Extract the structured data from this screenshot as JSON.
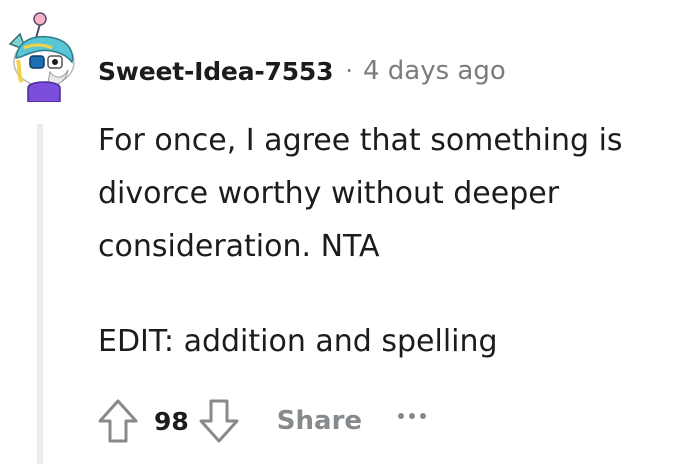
{
  "comment": {
    "author": "Sweet-Idea-7553",
    "separator": "·",
    "timestamp": "4 days ago",
    "body_lines": [
      "For once, I agree that something is divorce worthy without deeper consideration. NTA",
      "EDIT: addition and spelling"
    ],
    "score": "98",
    "share_label": "Share"
  },
  "icons": {
    "avatar": "snoo-avatar-icon",
    "upvote": "arrow-up-icon",
    "downvote": "arrow-down-icon",
    "more": "ellipsis-icon"
  },
  "colors": {
    "text": "#1c1c1c",
    "muted": "#7c7c7c",
    "action_gray": "#878a8c",
    "thread_line": "#ececec"
  }
}
